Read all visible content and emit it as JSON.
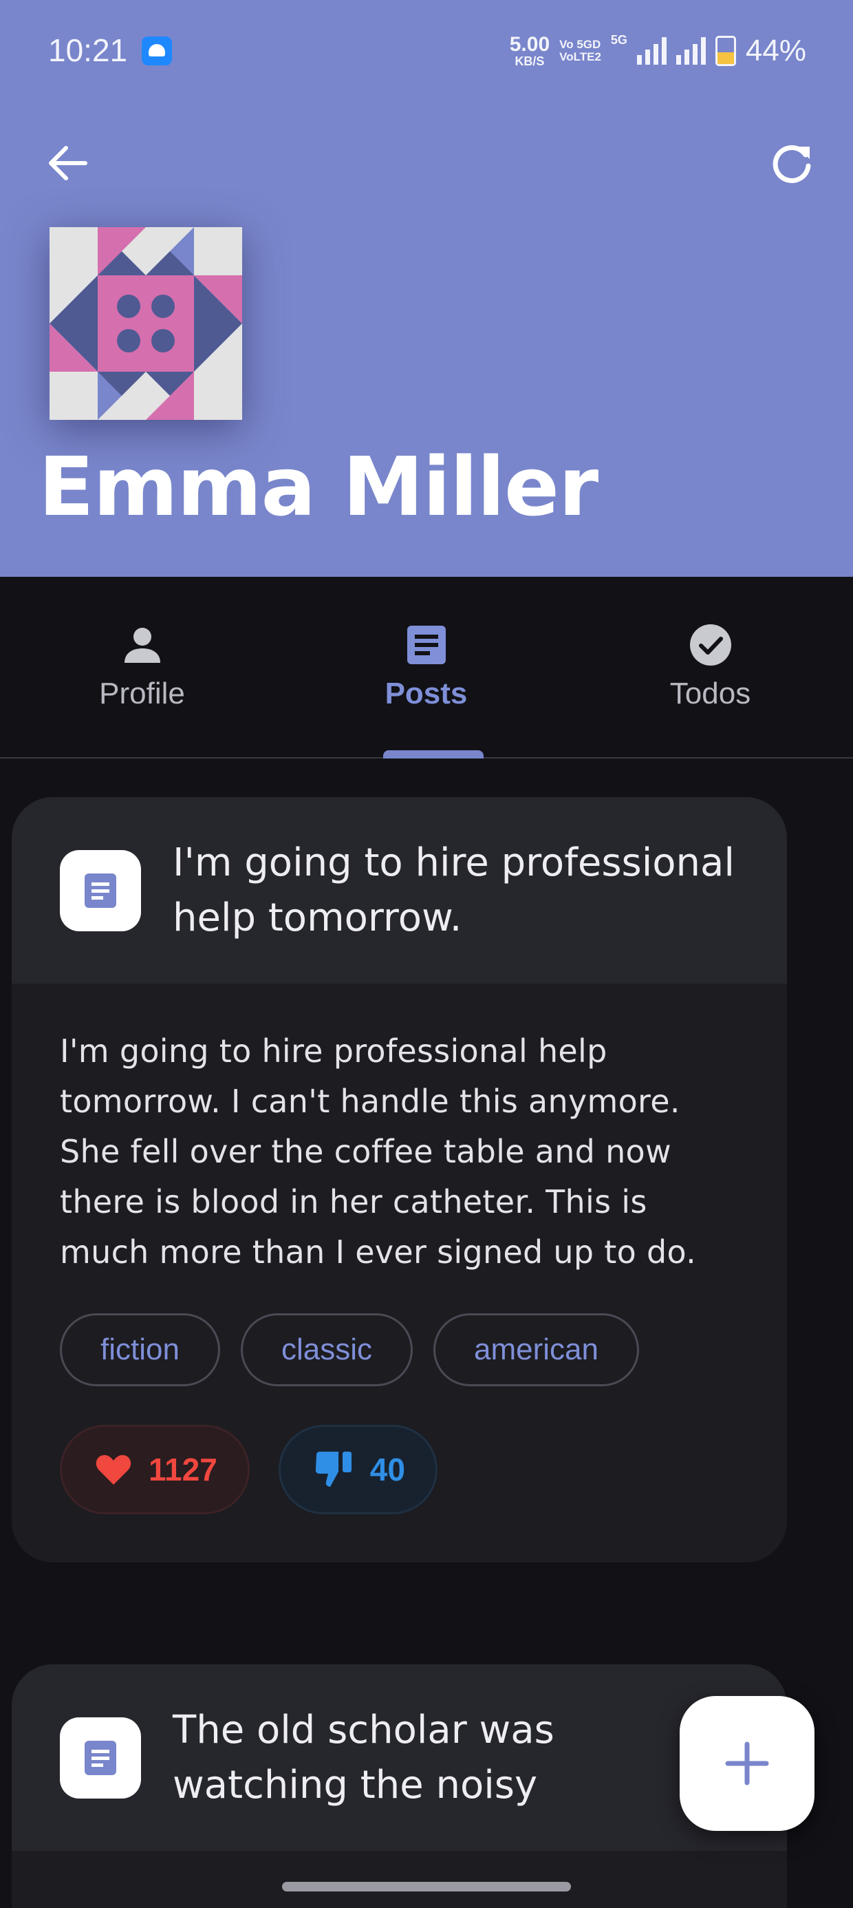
{
  "status_bar": {
    "time": "10:21",
    "net_speed_value": "5.00",
    "net_speed_unit": "KB/S",
    "volte_top": "Vo 5GD",
    "volte_bottom": "VoLTE2",
    "network_type": "5G",
    "battery_percent": "44%",
    "battery_level": 0.44
  },
  "header": {
    "user_name": "Emma Miller",
    "background_color": "#7986cb"
  },
  "tabs": [
    {
      "label": "Profile",
      "icon": "person-icon",
      "active": false
    },
    {
      "label": "Posts",
      "icon": "document-icon",
      "active": true
    },
    {
      "label": "Todos",
      "icon": "check-circle-icon",
      "active": false
    }
  ],
  "posts": [
    {
      "title": "I'm going to hire professional help tomorrow.",
      "body": "I'm going to hire professional help tomorrow. I can't handle this anymore. She fell over the coffee table and now there is blood in her catheter. This is much more than I ever signed up to do.",
      "tags": [
        "fiction",
        "classic",
        "american"
      ],
      "likes": "1127",
      "dislikes": "40"
    },
    {
      "title": "The old scholar was watching the noisy"
    }
  ],
  "fab": {
    "icon": "plus-icon"
  },
  "colors": {
    "accent": "#7986cb",
    "like": "#f0473f",
    "dislike": "#2f8fe6",
    "card": "#1c1c21"
  }
}
